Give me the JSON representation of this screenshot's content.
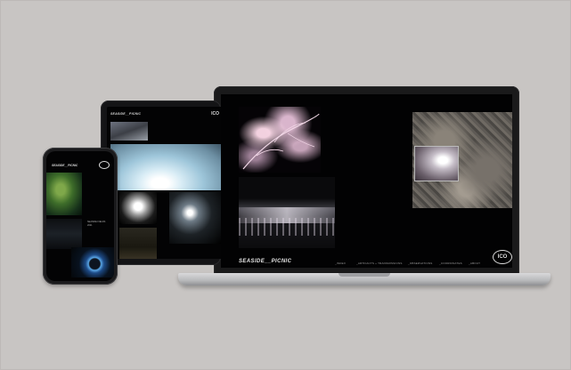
{
  "scene": {
    "background": "#c8c5c3"
  },
  "laptop": {
    "site_title": "SEASIDE__PICNIC",
    "nav": [
      "_INDEX",
      "_ARTIFACTS + TRANSMISSIONS",
      "_OBSERVATIONS",
      "_COORDINATES",
      "_ABOUT"
    ],
    "emblem": "ICO"
  },
  "tablet": {
    "site_title": "SEASIDE__PICNIC",
    "emblem": "ICO"
  },
  "phone": {
    "site_title": "SEASIDE__PICNIC",
    "caption": [
      "SEASIDE FIELDS",
      "2021"
    ]
  },
  "icons": {
    "emblem": "logo-emblem-icon"
  }
}
